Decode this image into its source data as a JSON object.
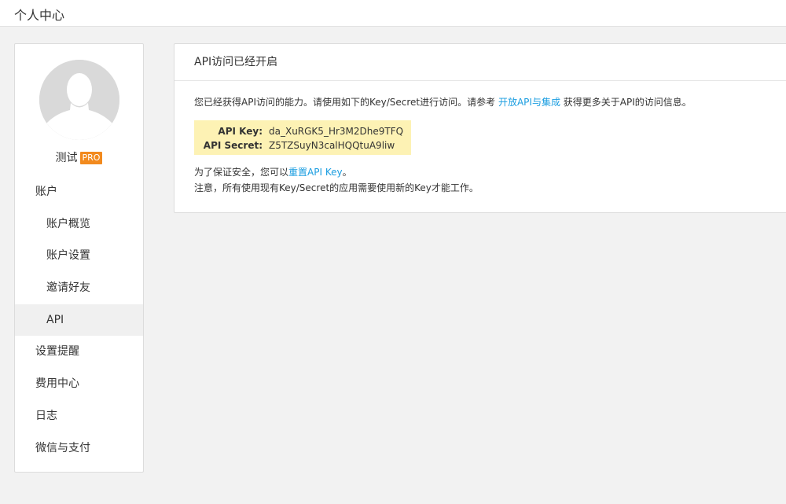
{
  "header": {
    "title": "个人中心"
  },
  "user": {
    "name": "测试",
    "badge": "PRO"
  },
  "menu": {
    "items": [
      {
        "label": "账户"
      },
      {
        "label": "账户概览"
      },
      {
        "label": "账户设置"
      },
      {
        "label": "邀请好友"
      },
      {
        "label": "API"
      },
      {
        "label": "设置提醒"
      },
      {
        "label": "费用中心"
      },
      {
        "label": "日志"
      },
      {
        "label": "微信与支付"
      }
    ]
  },
  "panel": {
    "title": "API访问已经开启",
    "desc_prefix": "您已经获得API访问的能力。请使用如下的Key/Secret进行访问。请参考 ",
    "desc_link": "开放API与集成",
    "desc_suffix": " 获得更多关于API的访问信息。",
    "api_key_label": "API Key:",
    "api_key_value": "da_XuRGK5_Hr3M2Dhe9TFQ",
    "api_secret_label": "API Secret:",
    "api_secret_value": "Z5TZSuyN3calHQQtuA9liw",
    "note1_prefix": "为了保证安全，您可以",
    "note1_link": "重置API Key",
    "note1_suffix": "。",
    "note2": "注意，所有使用现有Key/Secret的应用需要使用新的Key才能工作。"
  },
  "colors": {
    "accent_link": "#1a9de0",
    "badge": "#f28a1e",
    "key_highlight": "#fdf2b4"
  },
  "icons": {
    "avatar": "default-user-silhouette-icon"
  }
}
